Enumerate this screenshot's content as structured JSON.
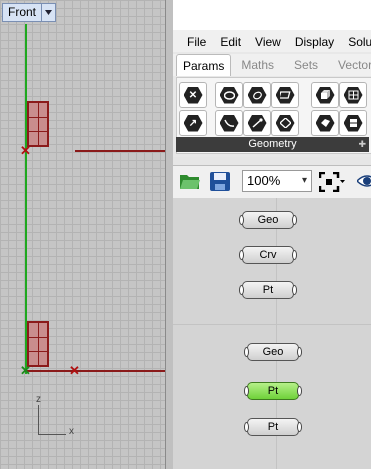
{
  "viewport": {
    "name": "Front",
    "axis_z": "z",
    "axis_x": "x",
    "colors": {
      "x_axis": "#8a1a1a",
      "y_axis": "#1fa81f",
      "geometry": "#c98d8d"
    }
  },
  "grasshopper": {
    "menu": [
      "File",
      "Edit",
      "View",
      "Display",
      "Solu"
    ],
    "tabs": [
      {
        "label": "Params",
        "active": true
      },
      {
        "label": "Maths",
        "active": false
      },
      {
        "label": "Sets",
        "active": false
      },
      {
        "label": "Vector",
        "active": false
      }
    ],
    "ribbon_group": "Geometry",
    "ribbon_icons": [
      "delete-icon",
      "circle-icon",
      "ring-icon",
      "surface-icon",
      "box-icon",
      "mesh-icon",
      "vector-icon",
      "curve-icon",
      "line-icon",
      "plane-icon",
      "brep-icon",
      "surface-patch-icon"
    ],
    "toolbar": {
      "zoom": "100%",
      "open_icon": "folder-open-icon",
      "save_icon": "save-icon"
    },
    "params": [
      {
        "label": "Geo",
        "highlight": false
      },
      {
        "label": "Crv",
        "highlight": false
      },
      {
        "label": "Pt",
        "highlight": false
      },
      {
        "label": "Geo",
        "highlight": false
      },
      {
        "label": "Pt",
        "highlight": true
      },
      {
        "label": "Pt",
        "highlight": false
      }
    ]
  }
}
